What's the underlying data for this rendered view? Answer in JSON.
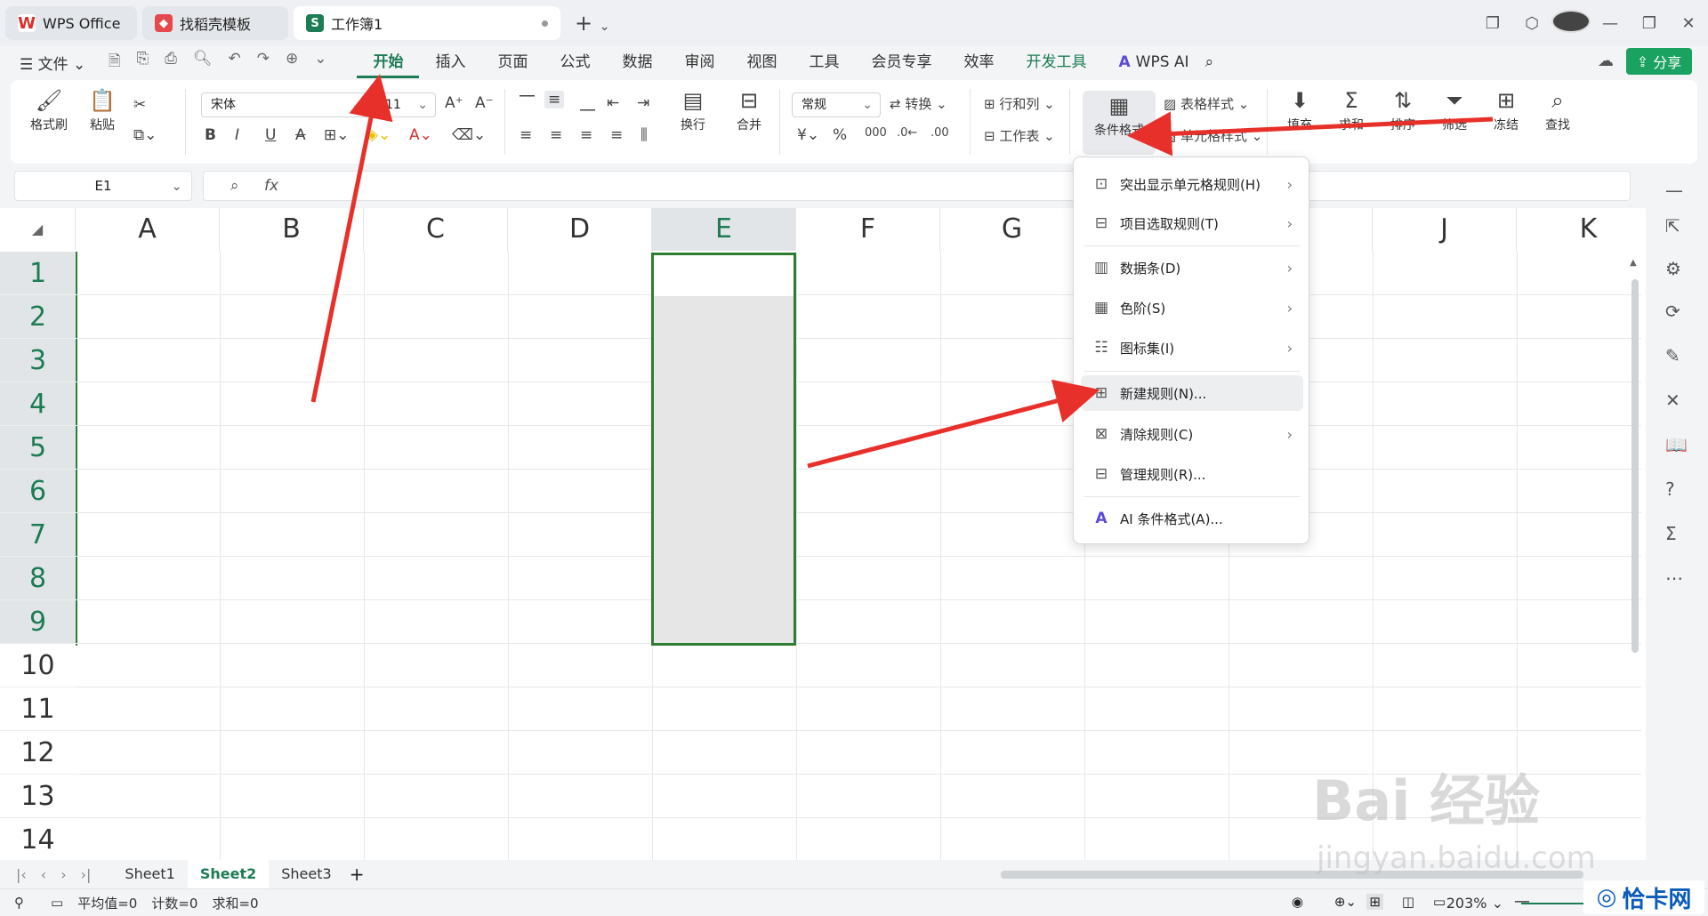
{
  "tabs": [
    {
      "label": "WPS Office",
      "icon": "wps-logo-icon"
    },
    {
      "label": "找稻壳模板",
      "icon": "docer-icon"
    },
    {
      "label": "工作簿1",
      "icon": "spreadsheet-icon"
    }
  ],
  "menubar": {
    "file": "☰ 文件 ⌄",
    "menus": [
      "开始",
      "插入",
      "页面",
      "公式",
      "数据",
      "审阅",
      "视图",
      "工具",
      "会员专享",
      "效率",
      "开发工具"
    ],
    "wps_ai": "WPS AI",
    "share": "分享"
  },
  "ribbon": {
    "format_painter": "格式刷",
    "paste": "粘贴",
    "font_name": "宋体",
    "font_size": "11",
    "wrap": "换行",
    "merge": "合并",
    "number_format": "常规",
    "convert": "转换",
    "rows_cols": "行和列",
    "worksheet": "工作表",
    "conditional_format": "条件格式",
    "table_style": "表格样式",
    "cell_style": "单元格样式",
    "fill": "填充",
    "sum": "求和",
    "sort": "排序",
    "filter": "筛选",
    "freeze": "冻结",
    "find": "查找"
  },
  "formula": {
    "name_box": "E1",
    "fx": "fx"
  },
  "grid": {
    "columns": [
      "A",
      "B",
      "C",
      "D",
      "E",
      "F",
      "G",
      "H",
      "I",
      "J",
      "K"
    ],
    "rows": [
      "1",
      "2",
      "3",
      "4",
      "5",
      "6",
      "7",
      "8",
      "9",
      "10",
      "11",
      "12",
      "13",
      "14"
    ],
    "selected_column": "E"
  },
  "dropdown": {
    "items": [
      {
        "label": "突出显示单元格规则(H)",
        "submenu": true
      },
      {
        "label": "项目选取规则(T)",
        "submenu": true
      },
      {
        "label": "数据条(D)",
        "submenu": true
      },
      {
        "label": "色阶(S)",
        "submenu": true
      },
      {
        "label": "图标集(I)",
        "submenu": true
      },
      {
        "label": "新建规则(N)...",
        "submenu": false
      },
      {
        "label": "清除规则(C)",
        "submenu": true
      },
      {
        "label": "管理规则(R)...",
        "submenu": false
      },
      {
        "label": "AI 条件格式(A)...",
        "submenu": false
      }
    ]
  },
  "sheets": [
    "Sheet1",
    "Sheet2",
    "Sheet3"
  ],
  "status": {
    "average": "平均值=0",
    "count": "计数=0",
    "sum": "求和=0",
    "zoom": "203%"
  },
  "watermark": {
    "line1": "Bai 经验",
    "line2": "jingyan.baidu.com",
    "logo": "恰卡网"
  },
  "colors": {
    "accent": "#1c7c54",
    "arrow": "#e8302a",
    "selection_border": "#2f7d32"
  }
}
